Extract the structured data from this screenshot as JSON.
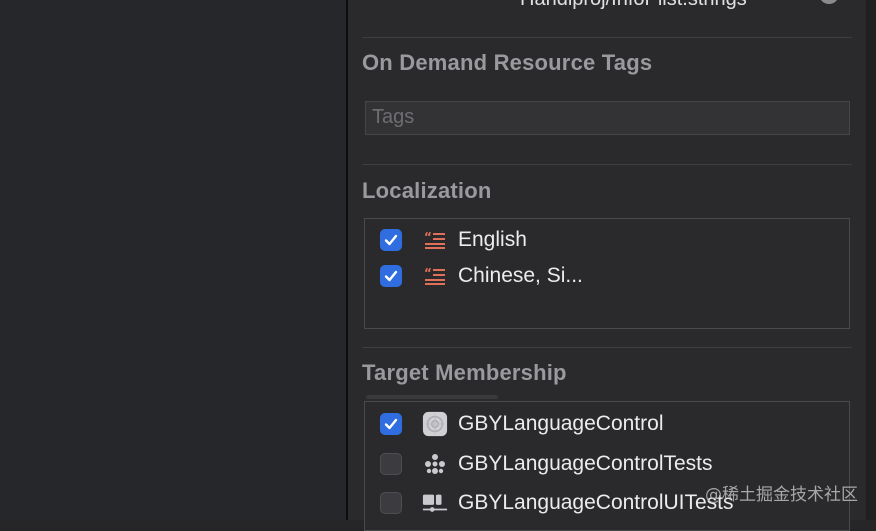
{
  "cut_off_file_text": "Handlproj/InfoPlist.strings",
  "sections": {
    "odr": {
      "title": "On Demand Resource Tags",
      "tags_placeholder": "Tags"
    },
    "localization": {
      "title": "Localization",
      "items": [
        {
          "label": "English",
          "checked": true,
          "icon": "strings-file-icon"
        },
        {
          "label": "Chinese, Si...",
          "checked": true,
          "icon": "strings-file-icon"
        }
      ]
    },
    "target_membership": {
      "title": "Target Membership",
      "items": [
        {
          "label": "GBYLanguageControl",
          "checked": true,
          "icon": "app-target-icon"
        },
        {
          "label": "GBYLanguageControlTests",
          "checked": false,
          "icon": "unit-test-target-icon"
        },
        {
          "label": "GBYLanguageControlUITests",
          "checked": false,
          "icon": "ui-test-target-icon"
        }
      ]
    }
  },
  "watermark": "@稀土掘金技术社区",
  "colors": {
    "accent": "#2f6de0",
    "strings_icon": "#e0705a"
  }
}
